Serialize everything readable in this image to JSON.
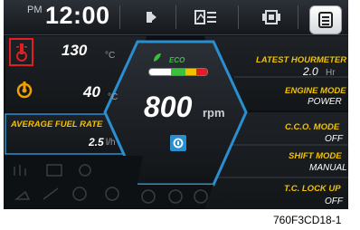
{
  "status_bar": {
    "ampm": "PM",
    "time": "12:00",
    "icons": [
      "beacon-light-icon",
      "manual-book-icon",
      "camera-view-icon",
      "menu-icon"
    ]
  },
  "left_panel": {
    "coolant_temp": {
      "value": "130",
      "unit": "°C",
      "icon": "coolant-temperature-icon"
    },
    "oil_temp": {
      "value": "40",
      "unit": "°C",
      "icon": "transmission-oil-temperature-icon"
    },
    "average_fuel_rate": {
      "label": "AVERAGE FUEL RATE",
      "value": "2.5",
      "unit": "l/h"
    }
  },
  "center": {
    "eco_label": "ECO",
    "rpm_value": "800",
    "rpm_unit": "rpm",
    "icon": "power-mode-icon"
  },
  "right_panel": {
    "latest_hourmeter": {
      "label": "LATEST HOURMETER",
      "value": "2.0",
      "unit": "Hr"
    },
    "engine_mode": {
      "label": "ENGINE MODE",
      "value": "POWER"
    },
    "cco_mode": {
      "label": "C.C.O. MODE",
      "value": "OFF"
    },
    "shift_mode": {
      "label": "SHIFT MODE",
      "value": "MANUAL"
    },
    "tc_lock_up": {
      "label": "T.C. LOCK UP",
      "value": "OFF"
    }
  },
  "caption": "760F3CD18-1",
  "colors": {
    "accent": "#f2c200",
    "highlight": "#e02020",
    "hex_border": "#2a8fd0",
    "coolant_icon": "#e02020",
    "oil_icon": "#f2a000"
  }
}
